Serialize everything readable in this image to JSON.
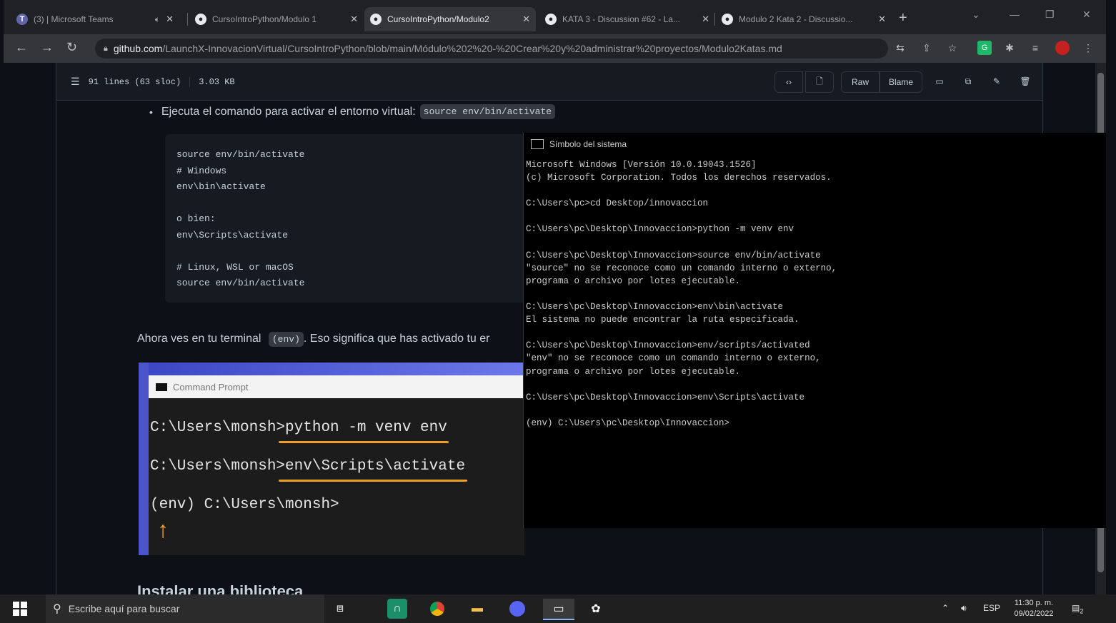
{
  "browser": {
    "tabs": [
      {
        "title": "(3) | Microsoft Teams",
        "icon": "teams-icon",
        "color": "#6264a7"
      },
      {
        "title": "CursoIntroPython/Modulo 1",
        "icon": "github-icon",
        "color": "#e8eaed"
      },
      {
        "title": "CursoIntroPython/Modulo2",
        "icon": "github-icon",
        "color": "#e8eaed"
      },
      {
        "title": "KATA 3 - Discussion #62 - La...",
        "icon": "github-icon",
        "color": "#e8eaed"
      },
      {
        "title": "Modulo 2 Kata 2 - Discussio...",
        "icon": "github-icon",
        "color": "#e8eaed"
      }
    ],
    "url_domain": "github.com",
    "url_path": "/LaunchX-InnovacionVirtual/CursoIntroPython/blob/main/Módulo%202%20-%20Crear%20y%20administrar%20proyectos/Modulo2Katas.md"
  },
  "file_header": {
    "lines": "91 lines (63 sloc)",
    "size": "3.03 KB",
    "raw_label": "Raw",
    "blame_label": "Blame"
  },
  "doc": {
    "bullet_text": "Ejecuta el comando para activar el entorno virtual:",
    "bullet_code": "source env/bin/activate",
    "code_block": "source env/bin/activate\n# Windows\nenv\\bin\\activate\n\no bien:\nenv\\Scripts\\activate\n\n# Linux, WSL or macOS\nsource env/bin/activate",
    "para_before": "Ahora ves en tu terminal",
    "para_code": "(env)",
    "para_after": ". Eso significa que has activado tu er",
    "next_heading": "Instalar una biblioteca"
  },
  "embedded_image": {
    "title": "Command Prompt",
    "line1": "C:\\Users\\monsh>python -m venv env",
    "line2": "C:\\Users\\monsh>env\\Scripts\\activate",
    "line3": "(env) C:\\Users\\monsh>",
    "accent": "#f0a020"
  },
  "cmd_window": {
    "title": "Símbolo del sistema",
    "output": "Microsoft Windows [Versión 10.0.19043.1526]\n(c) Microsoft Corporation. Todos los derechos reservados.\n\nC:\\Users\\pc>cd Desktop/innovaccion\n\nC:\\Users\\pc\\Desktop\\Innovaccion>python -m venv env\n\nC:\\Users\\pc\\Desktop\\Innovaccion>source env/bin/activate\n\"source\" no se reconoce como un comando interno o externo,\nprograma o archivo por lotes ejecutable.\n\nC:\\Users\\pc\\Desktop\\Innovaccion>env\\bin\\activate\nEl sistema no puede encontrar la ruta especificada.\n\nC:\\Users\\pc\\Desktop\\Innovaccion>env/scripts/activated\n\"env\" no se reconoce como un comando interno o externo,\nprograma o archivo por lotes ejecutable.\n\nC:\\Users\\pc\\Desktop\\Innovaccion>env\\Scripts\\activate\n\n(env) C:\\Users\\pc\\Desktop\\Innovaccion>"
  },
  "taskbar": {
    "search_placeholder": "Escribe aquí para buscar",
    "language": "ESP",
    "time": "11:30 p. m.",
    "date": "09/02/2022",
    "notifications": "2"
  }
}
